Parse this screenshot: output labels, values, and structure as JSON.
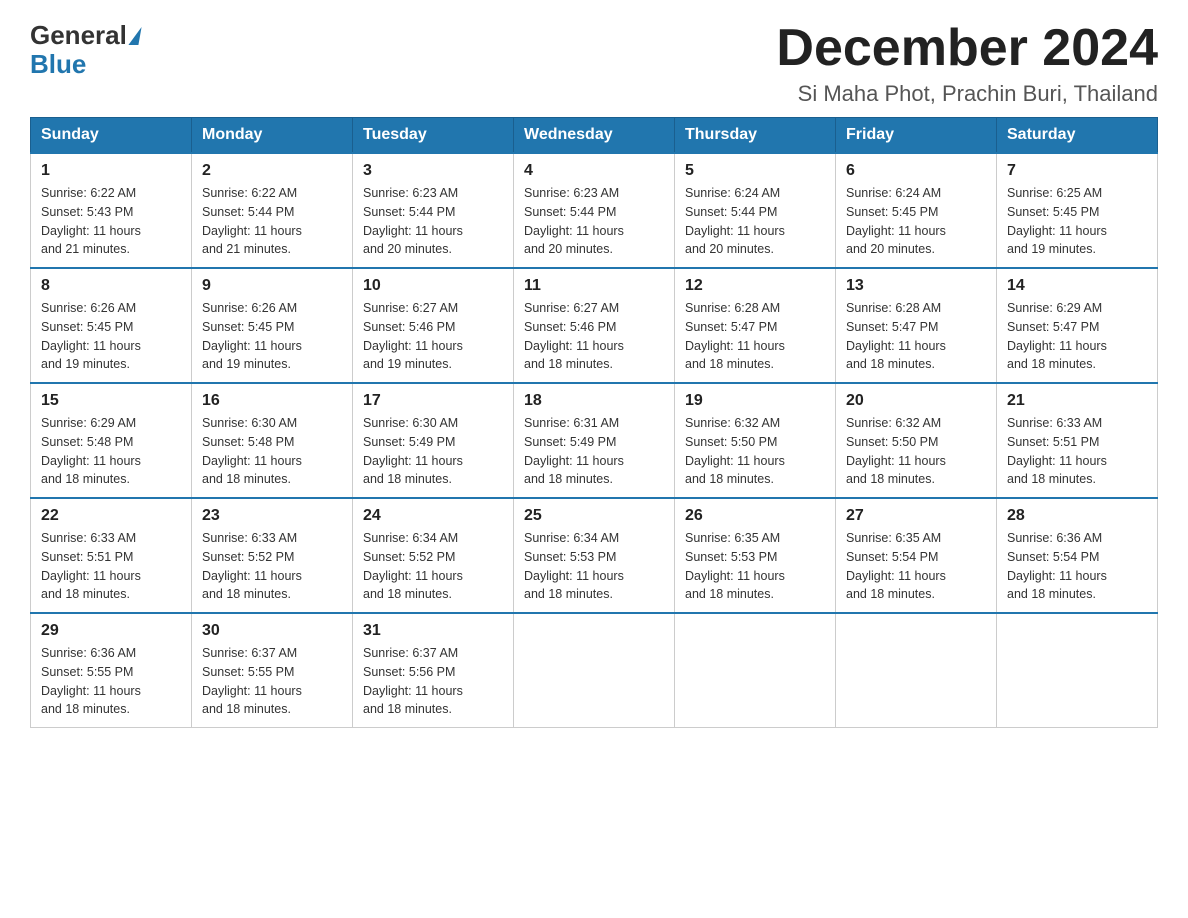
{
  "header": {
    "logo_general": "General",
    "logo_blue": "Blue",
    "month_title": "December 2024",
    "subtitle": "Si Maha Phot, Prachin Buri, Thailand"
  },
  "days_of_week": [
    "Sunday",
    "Monday",
    "Tuesday",
    "Wednesday",
    "Thursday",
    "Friday",
    "Saturday"
  ],
  "weeks": [
    [
      {
        "num": "1",
        "sunrise": "6:22 AM",
        "sunset": "5:43 PM",
        "daylight": "11 hours and 21 minutes."
      },
      {
        "num": "2",
        "sunrise": "6:22 AM",
        "sunset": "5:44 PM",
        "daylight": "11 hours and 21 minutes."
      },
      {
        "num": "3",
        "sunrise": "6:23 AM",
        "sunset": "5:44 PM",
        "daylight": "11 hours and 20 minutes."
      },
      {
        "num": "4",
        "sunrise": "6:23 AM",
        "sunset": "5:44 PM",
        "daylight": "11 hours and 20 minutes."
      },
      {
        "num": "5",
        "sunrise": "6:24 AM",
        "sunset": "5:44 PM",
        "daylight": "11 hours and 20 minutes."
      },
      {
        "num": "6",
        "sunrise": "6:24 AM",
        "sunset": "5:45 PM",
        "daylight": "11 hours and 20 minutes."
      },
      {
        "num": "7",
        "sunrise": "6:25 AM",
        "sunset": "5:45 PM",
        "daylight": "11 hours and 19 minutes."
      }
    ],
    [
      {
        "num": "8",
        "sunrise": "6:26 AM",
        "sunset": "5:45 PM",
        "daylight": "11 hours and 19 minutes."
      },
      {
        "num": "9",
        "sunrise": "6:26 AM",
        "sunset": "5:45 PM",
        "daylight": "11 hours and 19 minutes."
      },
      {
        "num": "10",
        "sunrise": "6:27 AM",
        "sunset": "5:46 PM",
        "daylight": "11 hours and 19 minutes."
      },
      {
        "num": "11",
        "sunrise": "6:27 AM",
        "sunset": "5:46 PM",
        "daylight": "11 hours and 18 minutes."
      },
      {
        "num": "12",
        "sunrise": "6:28 AM",
        "sunset": "5:47 PM",
        "daylight": "11 hours and 18 minutes."
      },
      {
        "num": "13",
        "sunrise": "6:28 AM",
        "sunset": "5:47 PM",
        "daylight": "11 hours and 18 minutes."
      },
      {
        "num": "14",
        "sunrise": "6:29 AM",
        "sunset": "5:47 PM",
        "daylight": "11 hours and 18 minutes."
      }
    ],
    [
      {
        "num": "15",
        "sunrise": "6:29 AM",
        "sunset": "5:48 PM",
        "daylight": "11 hours and 18 minutes."
      },
      {
        "num": "16",
        "sunrise": "6:30 AM",
        "sunset": "5:48 PM",
        "daylight": "11 hours and 18 minutes."
      },
      {
        "num": "17",
        "sunrise": "6:30 AM",
        "sunset": "5:49 PM",
        "daylight": "11 hours and 18 minutes."
      },
      {
        "num": "18",
        "sunrise": "6:31 AM",
        "sunset": "5:49 PM",
        "daylight": "11 hours and 18 minutes."
      },
      {
        "num": "19",
        "sunrise": "6:32 AM",
        "sunset": "5:50 PM",
        "daylight": "11 hours and 18 minutes."
      },
      {
        "num": "20",
        "sunrise": "6:32 AM",
        "sunset": "5:50 PM",
        "daylight": "11 hours and 18 minutes."
      },
      {
        "num": "21",
        "sunrise": "6:33 AM",
        "sunset": "5:51 PM",
        "daylight": "11 hours and 18 minutes."
      }
    ],
    [
      {
        "num": "22",
        "sunrise": "6:33 AM",
        "sunset": "5:51 PM",
        "daylight": "11 hours and 18 minutes."
      },
      {
        "num": "23",
        "sunrise": "6:33 AM",
        "sunset": "5:52 PM",
        "daylight": "11 hours and 18 minutes."
      },
      {
        "num": "24",
        "sunrise": "6:34 AM",
        "sunset": "5:52 PM",
        "daylight": "11 hours and 18 minutes."
      },
      {
        "num": "25",
        "sunrise": "6:34 AM",
        "sunset": "5:53 PM",
        "daylight": "11 hours and 18 minutes."
      },
      {
        "num": "26",
        "sunrise": "6:35 AM",
        "sunset": "5:53 PM",
        "daylight": "11 hours and 18 minutes."
      },
      {
        "num": "27",
        "sunrise": "6:35 AM",
        "sunset": "5:54 PM",
        "daylight": "11 hours and 18 minutes."
      },
      {
        "num": "28",
        "sunrise": "6:36 AM",
        "sunset": "5:54 PM",
        "daylight": "11 hours and 18 minutes."
      }
    ],
    [
      {
        "num": "29",
        "sunrise": "6:36 AM",
        "sunset": "5:55 PM",
        "daylight": "11 hours and 18 minutes."
      },
      {
        "num": "30",
        "sunrise": "6:37 AM",
        "sunset": "5:55 PM",
        "daylight": "11 hours and 18 minutes."
      },
      {
        "num": "31",
        "sunrise": "6:37 AM",
        "sunset": "5:56 PM",
        "daylight": "11 hours and 18 minutes."
      },
      null,
      null,
      null,
      null
    ]
  ],
  "labels": {
    "sunrise": "Sunrise:",
    "sunset": "Sunset:",
    "daylight": "Daylight:"
  }
}
